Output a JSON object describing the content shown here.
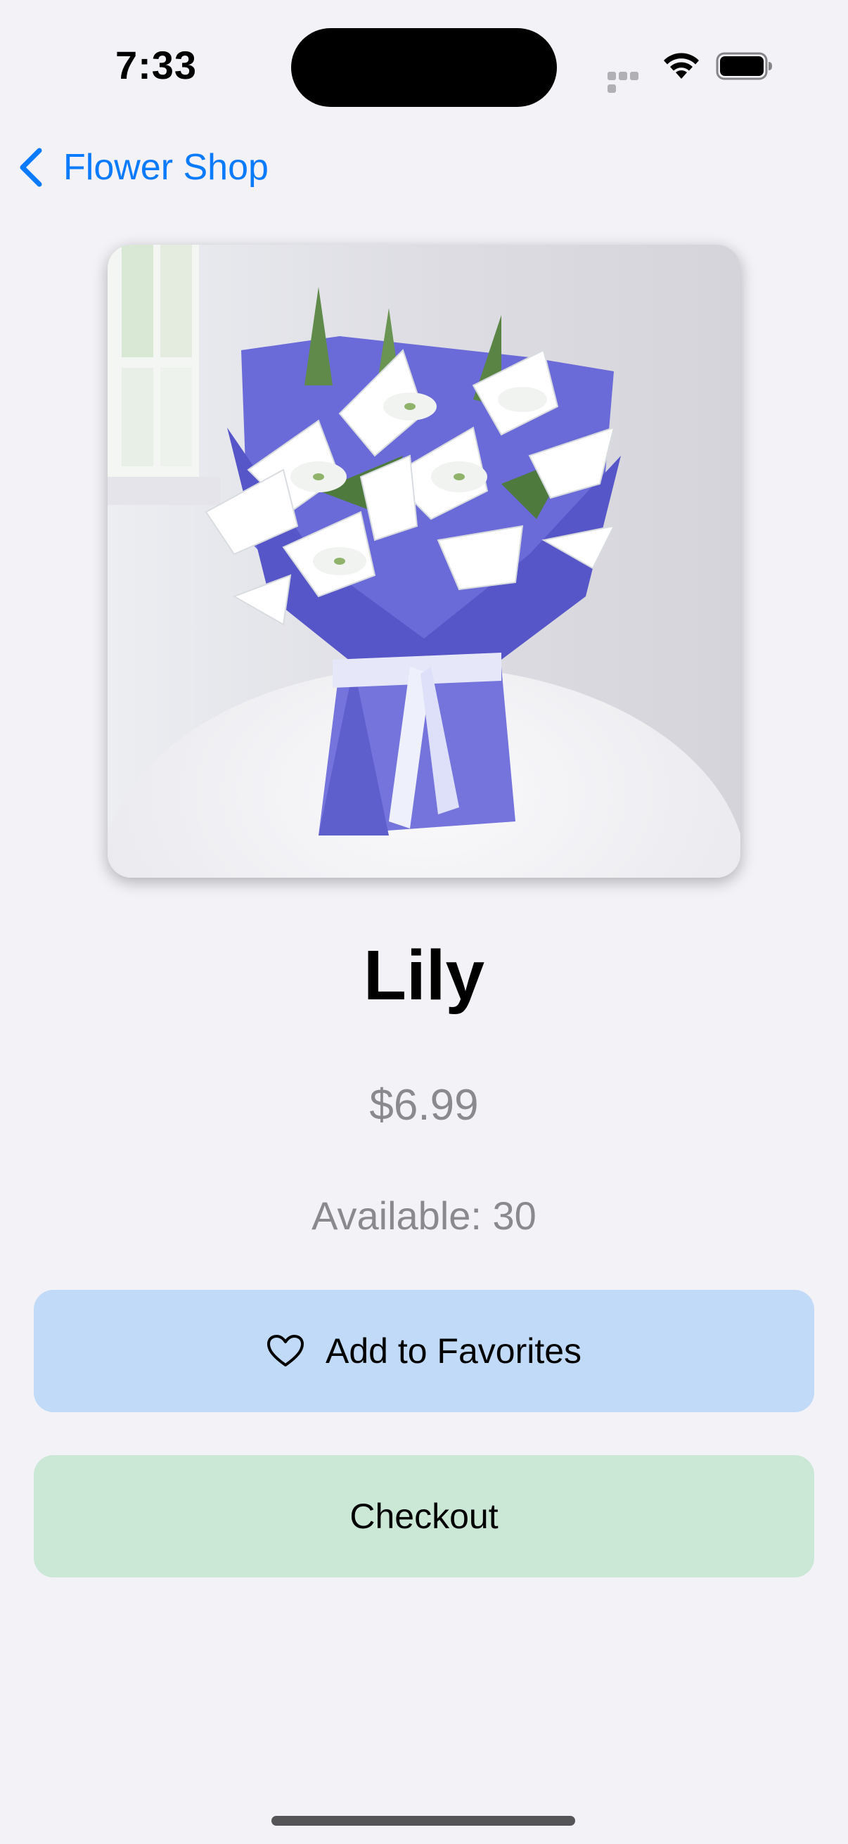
{
  "status_bar": {
    "time": "7:33"
  },
  "nav": {
    "back_label": "Flower Shop"
  },
  "product": {
    "name": "Lily",
    "price": "$6.99",
    "availability": "Available: 30",
    "image": "lily-bouquet-image"
  },
  "actions": {
    "favorites_label": "Add to Favorites",
    "favorites_icon": "heart-outline-icon",
    "checkout_label": "Checkout"
  },
  "colors": {
    "accent": "#0a7aff",
    "background": "#f2f2f7",
    "favorites_button": "#c1daf7",
    "checkout_button": "#cbe8d7",
    "secondary_text": "#8a8a8e"
  }
}
